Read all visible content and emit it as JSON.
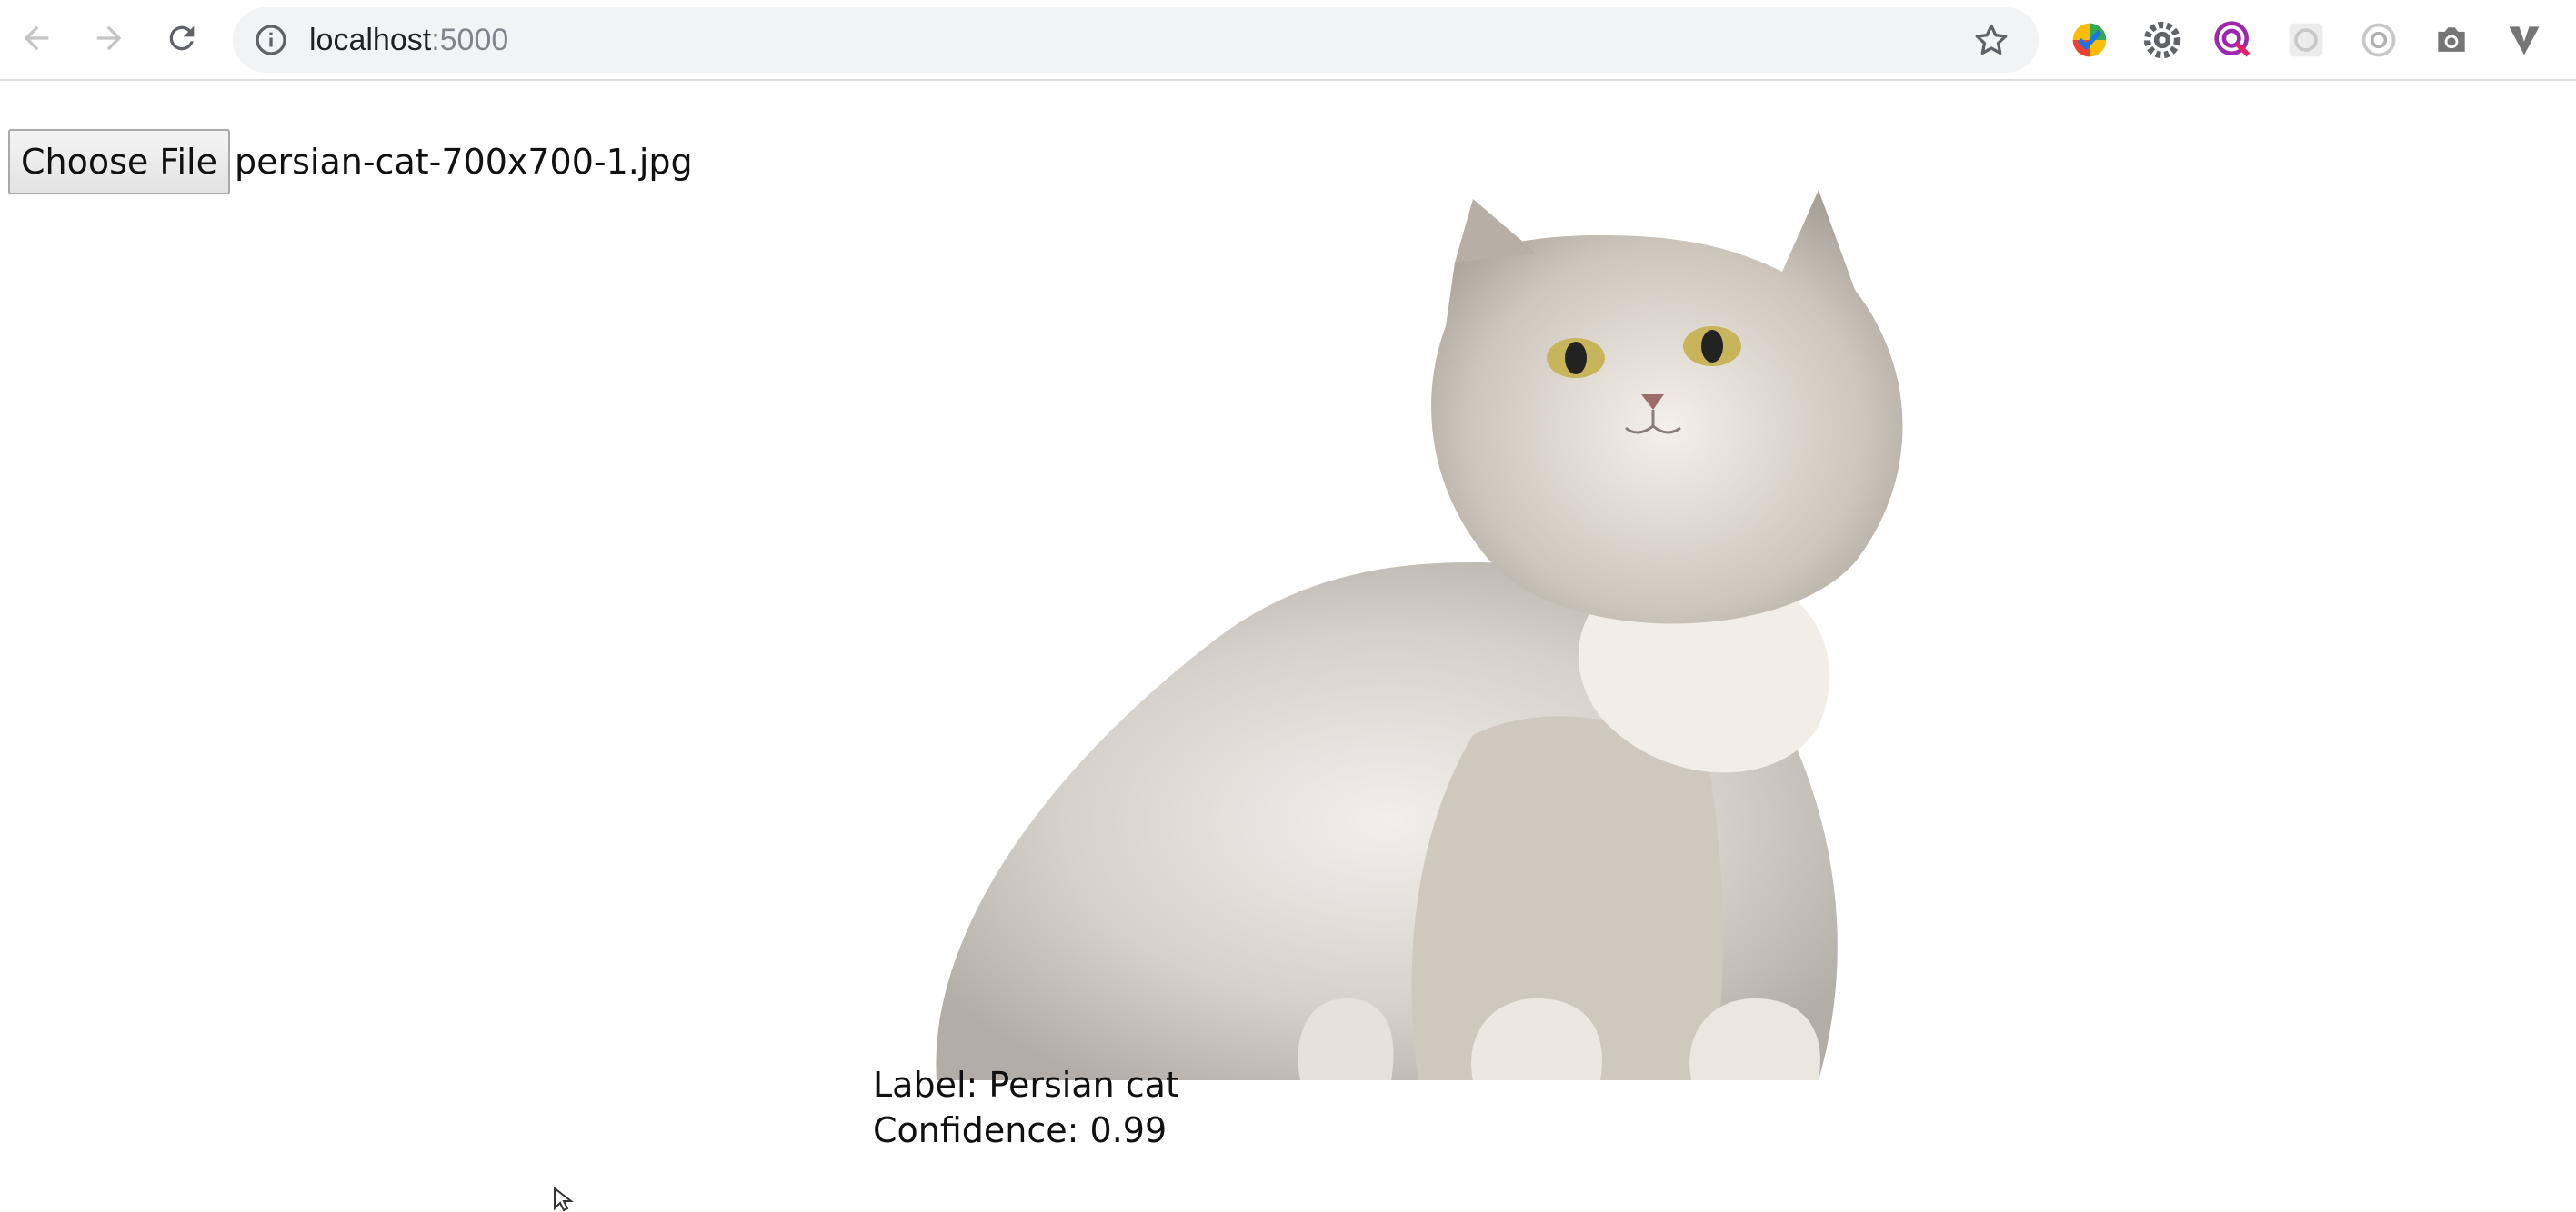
{
  "browser": {
    "url_host": "localhost",
    "url_port": ":5000",
    "icons": {
      "back": "arrow-left-icon",
      "forward": "arrow-right-icon",
      "reload": "reload-icon",
      "info": "info-icon",
      "bookmark": "star-icon"
    },
    "extensions": [
      {
        "name": "ext-checkmark-icon",
        "color": "#fbbc04"
      },
      {
        "name": "ext-gear-icon",
        "color": "#5f6368"
      },
      {
        "name": "ext-target-icon",
        "color": "#9c27b0"
      },
      {
        "name": "ext-flower-icon",
        "color": "#c0c0c0"
      },
      {
        "name": "ext-ring-icon",
        "color": "#9e9e9e"
      },
      {
        "name": "ext-camera-icon",
        "color": "#757575"
      },
      {
        "name": "ext-vivaldi-icon",
        "color": "#757575"
      }
    ]
  },
  "upload": {
    "button_label": "Choose File",
    "file_name": "persian-cat-700x700-1.jpg"
  },
  "result": {
    "label_line": "Label: Persian cat",
    "confidence_line": "Confidence: 0.99"
  }
}
